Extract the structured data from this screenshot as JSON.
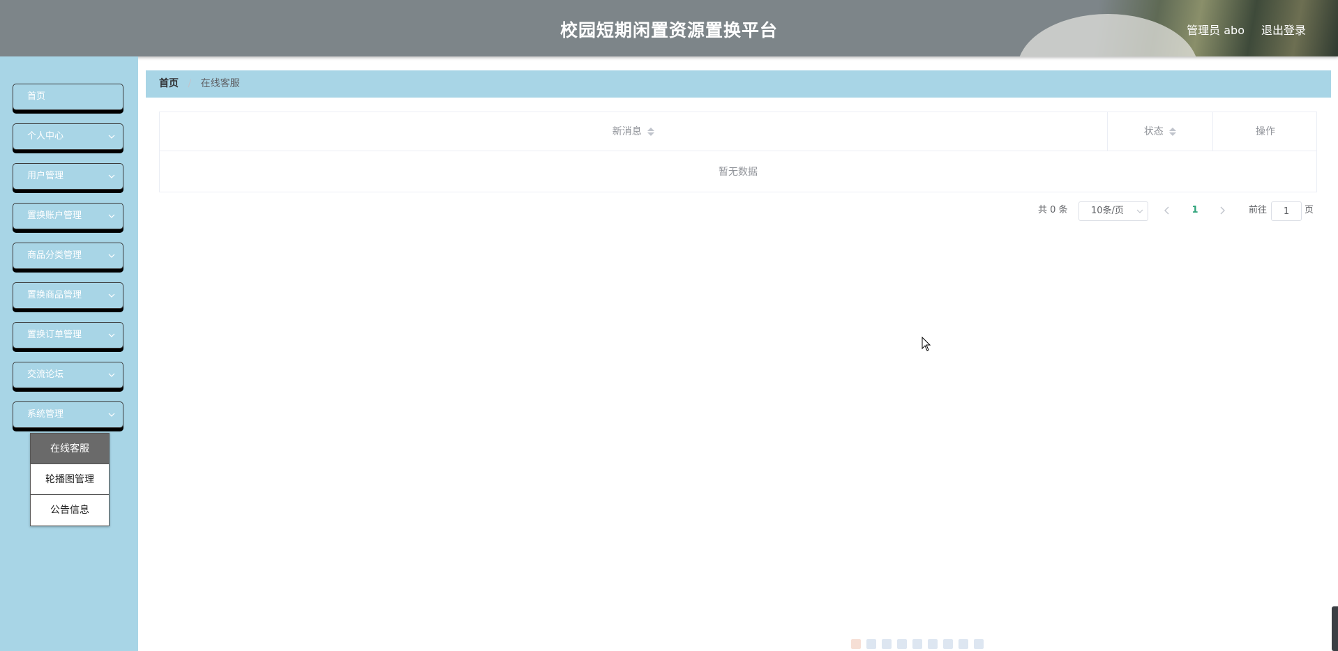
{
  "header": {
    "title": "校园短期闲置资源置换平台",
    "user_label": "管理员 abo",
    "logout_label": "退出登录"
  },
  "sidebar": {
    "items": [
      {
        "label": "首页",
        "has_arrow": false
      },
      {
        "label": "个人中心",
        "has_arrow": true
      },
      {
        "label": "用户管理",
        "has_arrow": true
      },
      {
        "label": "置换账户管理",
        "has_arrow": true
      },
      {
        "label": "商品分类管理",
        "has_arrow": true
      },
      {
        "label": "置换商品管理",
        "has_arrow": true
      },
      {
        "label": "置换订单管理",
        "has_arrow": true
      },
      {
        "label": "交流论坛",
        "has_arrow": true
      },
      {
        "label": "系统管理",
        "has_arrow": true
      }
    ],
    "submenu": [
      {
        "label": "在线客服",
        "active": true
      },
      {
        "label": "轮播图管理",
        "active": false
      },
      {
        "label": "公告信息",
        "active": false
      }
    ]
  },
  "breadcrumb": {
    "home": "首页",
    "separator": "/",
    "current": "在线客服"
  },
  "table": {
    "columns": [
      "新消息",
      "状态",
      "操作"
    ],
    "empty_text": "暂无数据"
  },
  "pagination": {
    "total_label": "共 0 条",
    "page_size": "10条/页",
    "current_page": "1",
    "goto_label": "前往",
    "goto_value": "1",
    "goto_unit": "页"
  },
  "colors": {
    "header_bg": "#7d8589",
    "sidebar_bg": "#a8d5e6",
    "breadcrumb_bg": "#a8d5e6",
    "active_page": "#2ea37a",
    "submenu_active_bg": "#6a6a6a"
  }
}
